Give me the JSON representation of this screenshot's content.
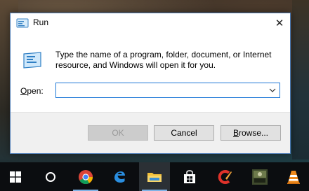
{
  "dialog": {
    "title": "Run",
    "close_glyph": "✕",
    "description": "Type the name of a program, folder, document, or Internet resource, and Windows will open it for you.",
    "open_label_first": "O",
    "open_label_rest": "pen:",
    "input_value": "",
    "buttons": {
      "ok": "OK",
      "cancel": "Cancel",
      "browse_first": "B",
      "browse_rest": "rowse..."
    }
  },
  "taskbar": {
    "items": [
      {
        "name": "start",
        "icon": "windows-logo-icon"
      },
      {
        "name": "search",
        "icon": "cortana-circle-icon"
      },
      {
        "name": "chrome",
        "icon": "chrome-icon"
      },
      {
        "name": "edge",
        "icon": "edge-icon"
      },
      {
        "name": "file-explorer",
        "icon": "folder-icon"
      },
      {
        "name": "store",
        "icon": "store-bag-icon"
      },
      {
        "name": "ccleaner",
        "icon": "ccleaner-icon"
      },
      {
        "name": "game-app",
        "icon": "game-app-icon"
      },
      {
        "name": "vlc",
        "icon": "vlc-cone-icon"
      }
    ]
  },
  "colors": {
    "taskbar": "#0b0d10",
    "dialog_border": "#4a7ab5",
    "input_border": "#1e78d7",
    "footer": "#f0f0f0"
  }
}
